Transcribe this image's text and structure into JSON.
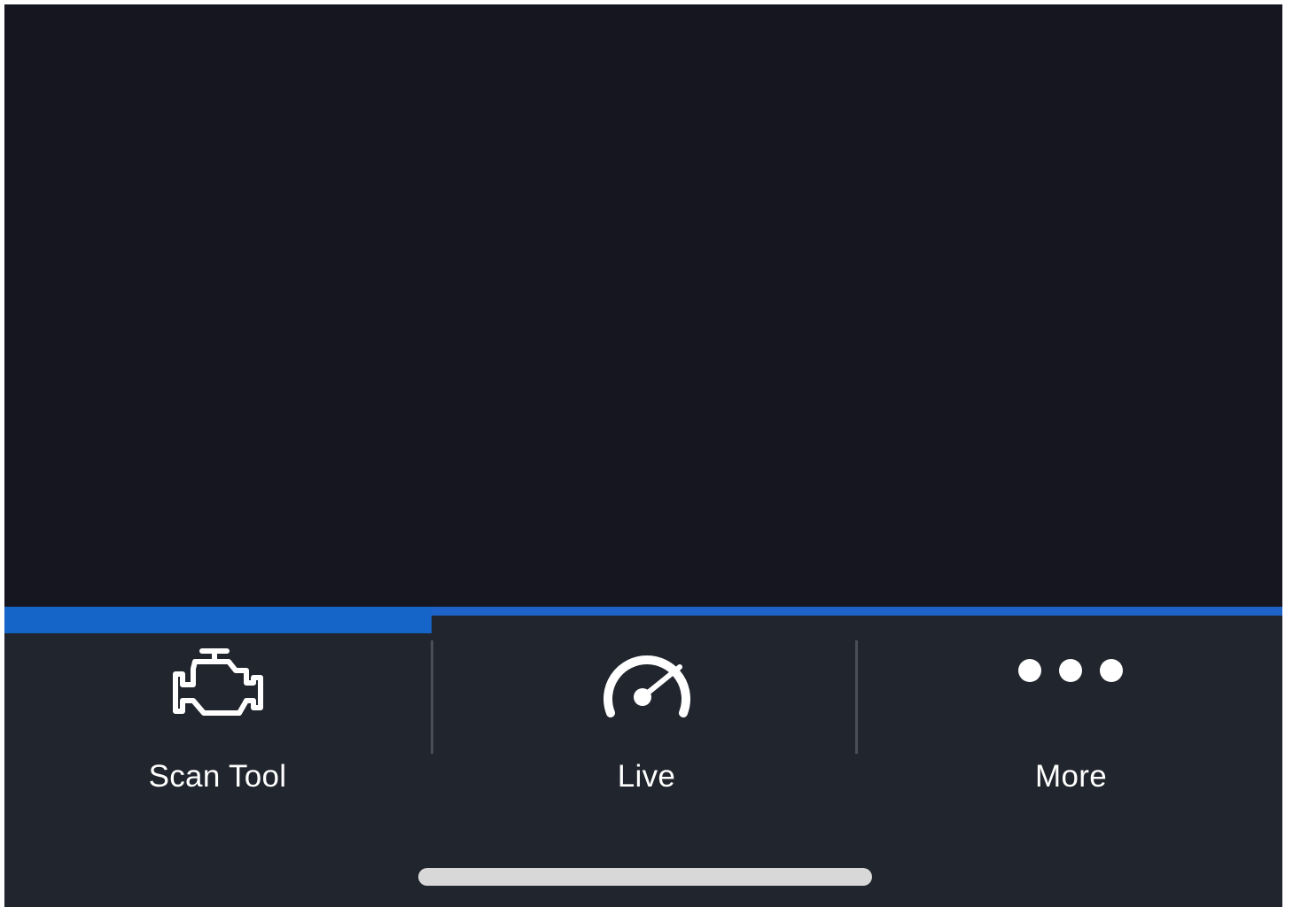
{
  "tab_bar": {
    "active_color": "#1565c8",
    "background_color": "#21252d",
    "tabs": [
      {
        "label": "Scan Tool",
        "icon": "check-engine-icon",
        "active": true
      },
      {
        "label": "Live",
        "icon": "speedometer-icon",
        "active": false
      },
      {
        "label": "More",
        "icon": "more-dots-icon",
        "active": false
      }
    ]
  }
}
